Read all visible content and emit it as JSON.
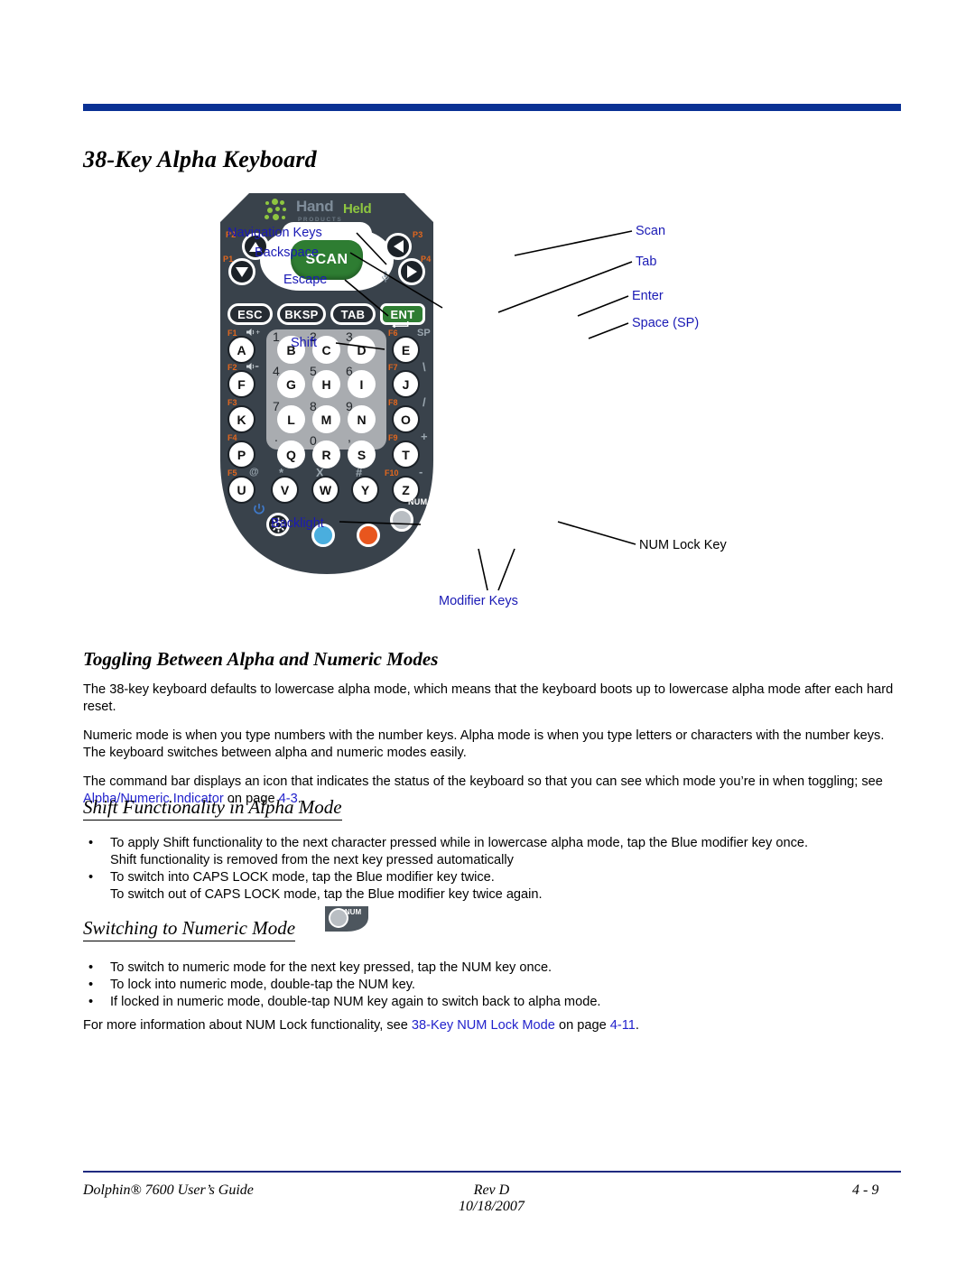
{
  "document": {
    "title": "38-Key Alpha Keyboard"
  },
  "figure": {
    "logo": {
      "hand": "Hand",
      "held": "Held",
      "products": "PRODUCTS"
    },
    "scan_button_label": "SCAN",
    "programmable_keys": [
      "P1",
      "P2",
      "P3",
      "P4"
    ],
    "function_row": [
      {
        "label": "ESC"
      },
      {
        "label": "BKSP"
      },
      {
        "label": "TAB"
      },
      {
        "label": "ENT"
      }
    ],
    "keypad_rows": [
      {
        "fn_left": "F1",
        "sym_left": "volume-up",
        "left_key": "A",
        "center_keys": [
          {
            "num": "1",
            "letter": "B"
          },
          {
            "num": "2",
            "letter": "C"
          },
          {
            "num": "3",
            "letter": "D"
          }
        ],
        "fn_right": "F6",
        "sym_right": "SP",
        "right_key": "E"
      },
      {
        "fn_left": "F2",
        "sym_left": "volume-down",
        "left_key": "F",
        "center_keys": [
          {
            "num": "4",
            "letter": "G"
          },
          {
            "num": "5",
            "letter": "H"
          },
          {
            "num": "6",
            "letter": "I"
          }
        ],
        "fn_right": "F7",
        "sym_right": "\\",
        "right_key": "J"
      },
      {
        "fn_left": "F3",
        "sym_left": "",
        "left_key": "K",
        "center_keys": [
          {
            "num": "7",
            "letter": "L"
          },
          {
            "num": "8",
            "letter": "M"
          },
          {
            "num": "9",
            "letter": "N"
          }
        ],
        "fn_right": "F8",
        "sym_right": "/",
        "right_key": "O"
      },
      {
        "fn_left": "F4",
        "sym_left": "",
        "left_key": "P",
        "center_keys": [
          {
            "num": ".",
            "letter": "Q"
          },
          {
            "num": "0",
            "letter": "R"
          },
          {
            "num": ",",
            "letter": "S"
          }
        ],
        "fn_right": "F9",
        "sym_right": "+",
        "right_key": "T"
      },
      {
        "fn_left": "F5",
        "sym_left": "@",
        "left_key": "U",
        "center_keys": [
          {
            "num": "*",
            "letter": "V"
          },
          {
            "num": "X",
            "letter": "W"
          },
          {
            "num": "#",
            "letter": "Y"
          }
        ],
        "fn_right": "F10",
        "sym_right": "-",
        "right_key": "Z"
      }
    ],
    "bottom_keys": {
      "backlight": "backlight-key",
      "blue_modifier": "blue-modifier-key",
      "orange_modifier": "orange-modifier-key",
      "num_lock": "NUM"
    },
    "callouts_left": [
      "Navigation Keys",
      "Backspace",
      "Escape",
      "Shift",
      "Backlight"
    ],
    "callouts_right": [
      "Scan",
      "Tab",
      "Enter",
      "Space (SP)"
    ],
    "callout_num_lock": "NUM Lock Key",
    "callout_bottom": "Modifier Keys"
  },
  "sections": {
    "toggling": {
      "heading": "Toggling Between Alpha and Numeric Modes",
      "p1": "The 38-key keyboard defaults to lowercase alpha mode, which means that the keyboard boots up to lowercase alpha mode after each hard reset.",
      "p2": "Numeric mode is when you type numbers with the number keys. Alpha mode is when you type letters or characters with the number keys. The keyboard switches between alpha and numeric modes easily.",
      "p3_before": "The command bar displays an icon that indicates the status of the keyboard so that you can see which mode you’re in when toggling; see ",
      "p3_link": "Alpha/Numeric Indicator",
      "p3_mid": " on page ",
      "p3_page": "4-3",
      "p3_after": "."
    },
    "shift": {
      "heading": "Shift Functionality in Alpha Mode",
      "bullet1_line1": "To apply Shift functionality to the next character pressed while in lowercase alpha mode, tap the Blue modifier key once.",
      "bullet1_line2": "Shift functionality is removed from the next key pressed automatically",
      "bullet2_line1": "To switch into CAPS LOCK mode, tap the Blue modifier key twice.",
      "bullet2_line2": "To switch out of CAPS LOCK mode, tap the Blue modifier key twice again."
    },
    "numeric": {
      "heading": "Switching to Numeric Mode",
      "icon_label": "NUM",
      "bullet1": "To switch to numeric mode for the next key pressed, tap the NUM key once.",
      "bullet2": "To lock into numeric mode, double-tap the NUM key.",
      "bullet3": "If locked in numeric mode, double-tap NUM key again to switch back to alpha mode.",
      "closing_before": "For more information about NUM Lock functionality, see ",
      "closing_link": "38-Key NUM Lock Mode",
      "closing_mid": " on page ",
      "closing_page": "4-11",
      "closing_after": "."
    }
  },
  "footer": {
    "left": "Dolphin® 7600 User’s Guide",
    "center_line1": "Rev D",
    "center_line2": "10/18/2007",
    "right": "4 - 9"
  },
  "bullet_glyph": "•",
  "colors": {
    "header_rule": "#0a3194",
    "link": "#2222cc",
    "callout": "#1a1ab5",
    "device_body": "#39424b",
    "keypad_inset": "#a9acb0",
    "scan_green": "#2e7d32",
    "orange_label": "#e2671e",
    "logo_green": "#8ec640",
    "blue_key": "#4aaede",
    "orange_key": "#e8561e"
  }
}
